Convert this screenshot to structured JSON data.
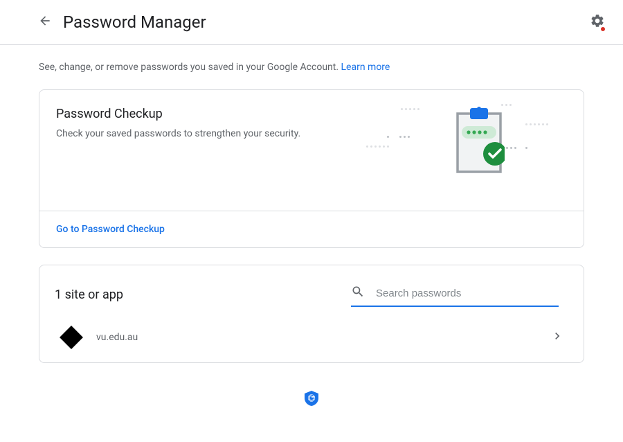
{
  "header": {
    "title": "Password Manager"
  },
  "intro": {
    "text": "See, change, or remove passwords you saved in your Google Account. ",
    "learn_more": "Learn more"
  },
  "password_checkup": {
    "title": "Password Checkup",
    "subtitle": "Check your saved passwords to strengthen your security.",
    "link_label": "Go to Password Checkup"
  },
  "sites": {
    "title": "1 site or app",
    "search_placeholder": "Search passwords",
    "items": [
      {
        "name": "vu.edu.au"
      }
    ]
  }
}
